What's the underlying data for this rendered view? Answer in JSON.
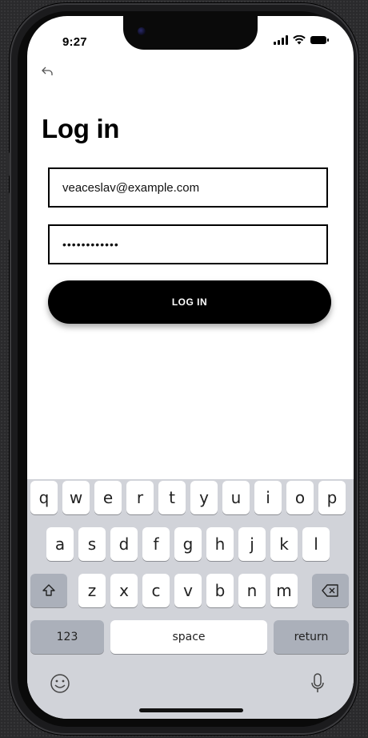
{
  "status_bar": {
    "time": "9:27"
  },
  "nav": {
    "back_icon": "back-arrow-icon"
  },
  "page": {
    "title": "Log in"
  },
  "form": {
    "email_value": "veaceslav@example.com",
    "password_value": "••••••••••••",
    "login_label": "LOG IN"
  },
  "keyboard": {
    "row1": [
      "q",
      "w",
      "e",
      "r",
      "t",
      "y",
      "u",
      "i",
      "o",
      "p"
    ],
    "row2": [
      "a",
      "s",
      "d",
      "f",
      "g",
      "h",
      "j",
      "k",
      "l"
    ],
    "row3": [
      "z",
      "x",
      "c",
      "v",
      "b",
      "n",
      "m"
    ],
    "numbers_label": "123",
    "space_label": "space",
    "return_label": "return"
  }
}
